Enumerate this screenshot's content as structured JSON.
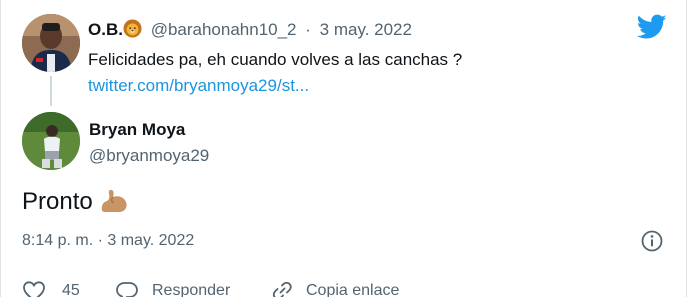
{
  "parent_tweet": {
    "author_name": "O.B.",
    "handle": "@barahonahn10_2",
    "separator": "·",
    "date": "3 may. 2022",
    "text": "Felicidades pa, eh cuando volves a las canchas ?",
    "link": "twitter.com/bryanmoya29/st..."
  },
  "main_tweet": {
    "author_name": "Bryan Moya",
    "handle": "@bryanmoya29",
    "text": "Pronto",
    "timestamp": "8:14 p. m. · 3 may. 2022"
  },
  "actions": {
    "like_count": "45",
    "reply_label": "Responder",
    "copy_link_label": "Copia enlace"
  },
  "colors": {
    "twitter_blue": "#1d9bf0",
    "link_blue": "#1b95e0",
    "text_primary": "#0f1419",
    "text_secondary": "#536471"
  },
  "icons": {
    "brand": "twitter-bird-icon",
    "name_emoji": "lion-face-icon",
    "text_emoji": "flexed-biceps-icon",
    "info": "info-icon",
    "like": "heart-icon",
    "reply": "speech-bubble-icon",
    "copy": "link-icon"
  }
}
